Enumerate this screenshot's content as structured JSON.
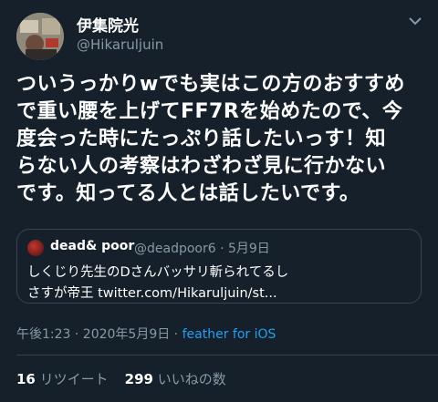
{
  "author": {
    "display_name": "伊集院光",
    "handle": "@Hikaruljuin"
  },
  "tweet": {
    "lines": [
      "ついうっかりwでも実はこの方のおすすめ",
      "で重い腰を上げてFF7Rを始めたので、今",
      "度会った時にたっぷり話したいっす！知",
      "らない人の考察はわざわざ見に行かない",
      "です。知ってる人とは話したいです。"
    ]
  },
  "quote": {
    "name": "dead& poor",
    "handle_date": "@deadpoor6 · 5月9日",
    "line1": "しくじり先生のDさんバッサリ斬られてるし",
    "line2": "さすが帝王 twitter.com/Hikaruljuin/st..."
  },
  "meta": {
    "timestamp": "午後1:23 · 2020年5月9日 · ",
    "source": "feather for iOS"
  },
  "stats": {
    "retweets_count": "16",
    "retweets_label": "リツイート",
    "likes_count": "299",
    "likes_label": "いいねの数"
  },
  "colors": {
    "background": "#15202b",
    "muted": "#8899a6",
    "accent": "#1da1f2",
    "border": "#38444d"
  },
  "icons": {
    "more": "chevron-down-icon"
  }
}
